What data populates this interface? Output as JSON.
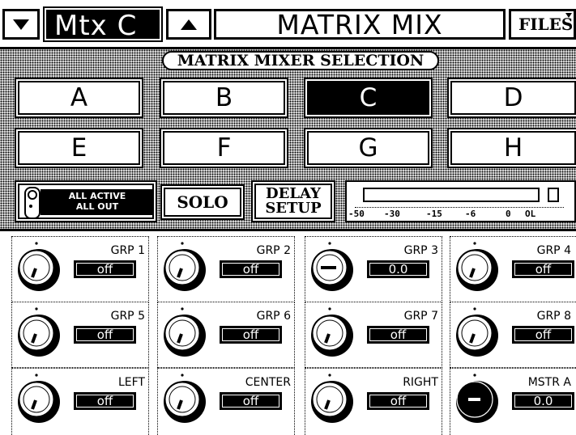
{
  "header": {
    "matrix_label": "Mtx C",
    "title": "MATRIX MIX",
    "files_label": "FILES"
  },
  "selection": {
    "title": "MATRIX MIXER SELECTION",
    "buttons": [
      {
        "label": "A",
        "active": false
      },
      {
        "label": "B",
        "active": false
      },
      {
        "label": "C",
        "active": true
      },
      {
        "label": "D",
        "active": false
      },
      {
        "label": "E",
        "active": false
      },
      {
        "label": "F",
        "active": false
      },
      {
        "label": "G",
        "active": false
      },
      {
        "label": "H",
        "active": false
      }
    ]
  },
  "controls": {
    "all_active_line1": "ALL ACTIVE",
    "all_active_line2": "ALL OUT",
    "solo_label": "SOLO",
    "delay_line1": "DELAY",
    "delay_line2": "SETUP"
  },
  "meter": {
    "scale": [
      "-50",
      "-30",
      "-15",
      "-6",
      "0",
      "OL"
    ],
    "level": 0
  },
  "knobs": [
    {
      "name": "GRP 1",
      "value": "off",
      "style": "off"
    },
    {
      "name": "GRP 2",
      "value": "off",
      "style": "off"
    },
    {
      "name": "GRP 3",
      "value": "0.0",
      "style": "unity"
    },
    {
      "name": "GRP 4",
      "value": "off",
      "style": "off"
    },
    {
      "name": "GRP 5",
      "value": "off",
      "style": "off"
    },
    {
      "name": "GRP 6",
      "value": "off",
      "style": "off"
    },
    {
      "name": "GRP 7",
      "value": "off",
      "style": "off"
    },
    {
      "name": "GRP 8",
      "value": "off",
      "style": "off"
    },
    {
      "name": "LEFT",
      "value": "off",
      "style": "off"
    },
    {
      "name": "CENTER",
      "value": "off",
      "style": "off"
    },
    {
      "name": "RIGHT",
      "value": "off",
      "style": "off"
    },
    {
      "name": "MSTR A",
      "value": "0.0",
      "style": "master"
    }
  ]
}
